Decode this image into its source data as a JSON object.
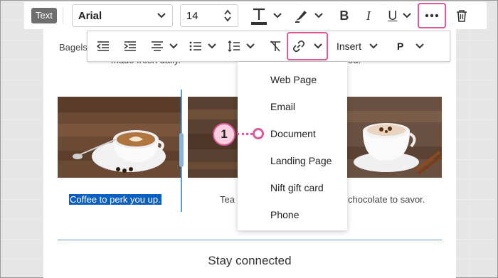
{
  "toolbar": {
    "mode_badge": "Text",
    "font_family_value": "Arial",
    "font_size_value": "14",
    "bold_label": "B",
    "italic_label": "I",
    "underline_label": "U"
  },
  "format_toolbar": {
    "insert_label": "Insert",
    "paragraph_label": "P"
  },
  "content": {
    "body_text_left": "Bagels",
    "body_text_right_fragment": "ed.",
    "body_text_line2": "made fresh daily.",
    "caption_left": "Coffee to perk you up.",
    "caption_mid": "Tea",
    "caption_right": "chocolate to savor.",
    "footer_heading": "Stay connected"
  },
  "link_menu": {
    "items": [
      "Web Page",
      "Email",
      "Document",
      "Landing Page",
      "Nift gift card",
      "Phone"
    ]
  },
  "callout": {
    "number": "1"
  },
  "colors": {
    "highlight": "#e0589a",
    "selection": "#0a5fbf",
    "guide": "#5b9bd5"
  }
}
